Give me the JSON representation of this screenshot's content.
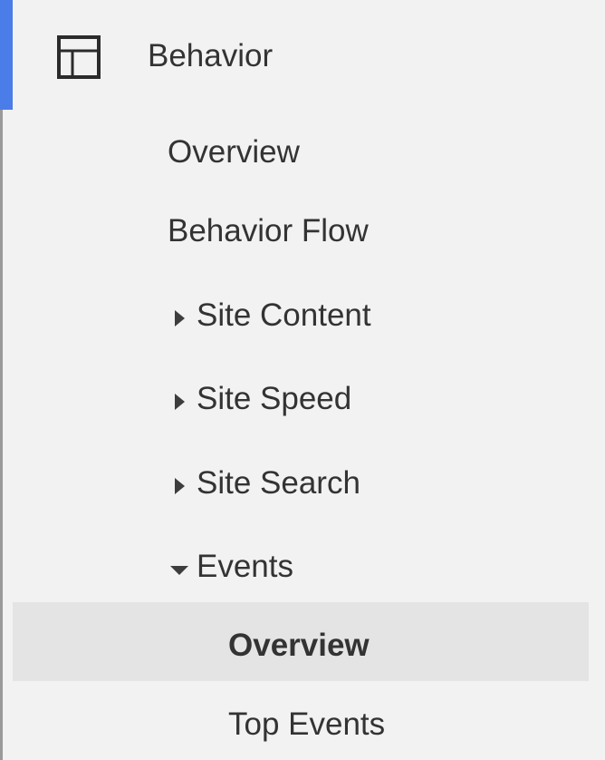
{
  "section": {
    "title": "Behavior",
    "icon": "layout-icon",
    "accent_color": "#4a7de8"
  },
  "items": {
    "overview": "Overview",
    "behavior_flow": "Behavior Flow",
    "site_content": "Site Content",
    "site_speed": "Site Speed",
    "site_search": "Site Search",
    "events": "Events",
    "events_overview": "Overview",
    "top_events": "Top Events"
  }
}
